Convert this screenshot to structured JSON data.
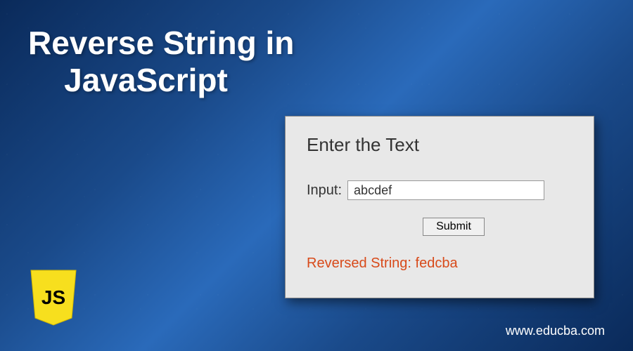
{
  "title": {
    "line1": "Reverse String in",
    "line2": "JavaScript"
  },
  "form": {
    "header": "Enter the Text",
    "input_label": "Input:",
    "input_value": "abcdef",
    "submit_label": "Submit",
    "output_label": "Reversed String:",
    "output_value": "fedcba"
  },
  "logo": {
    "text": "JS"
  },
  "footer": {
    "url": "www.educba.com"
  },
  "colors": {
    "shield": "#f7df1e",
    "output": "#d84a1a"
  }
}
